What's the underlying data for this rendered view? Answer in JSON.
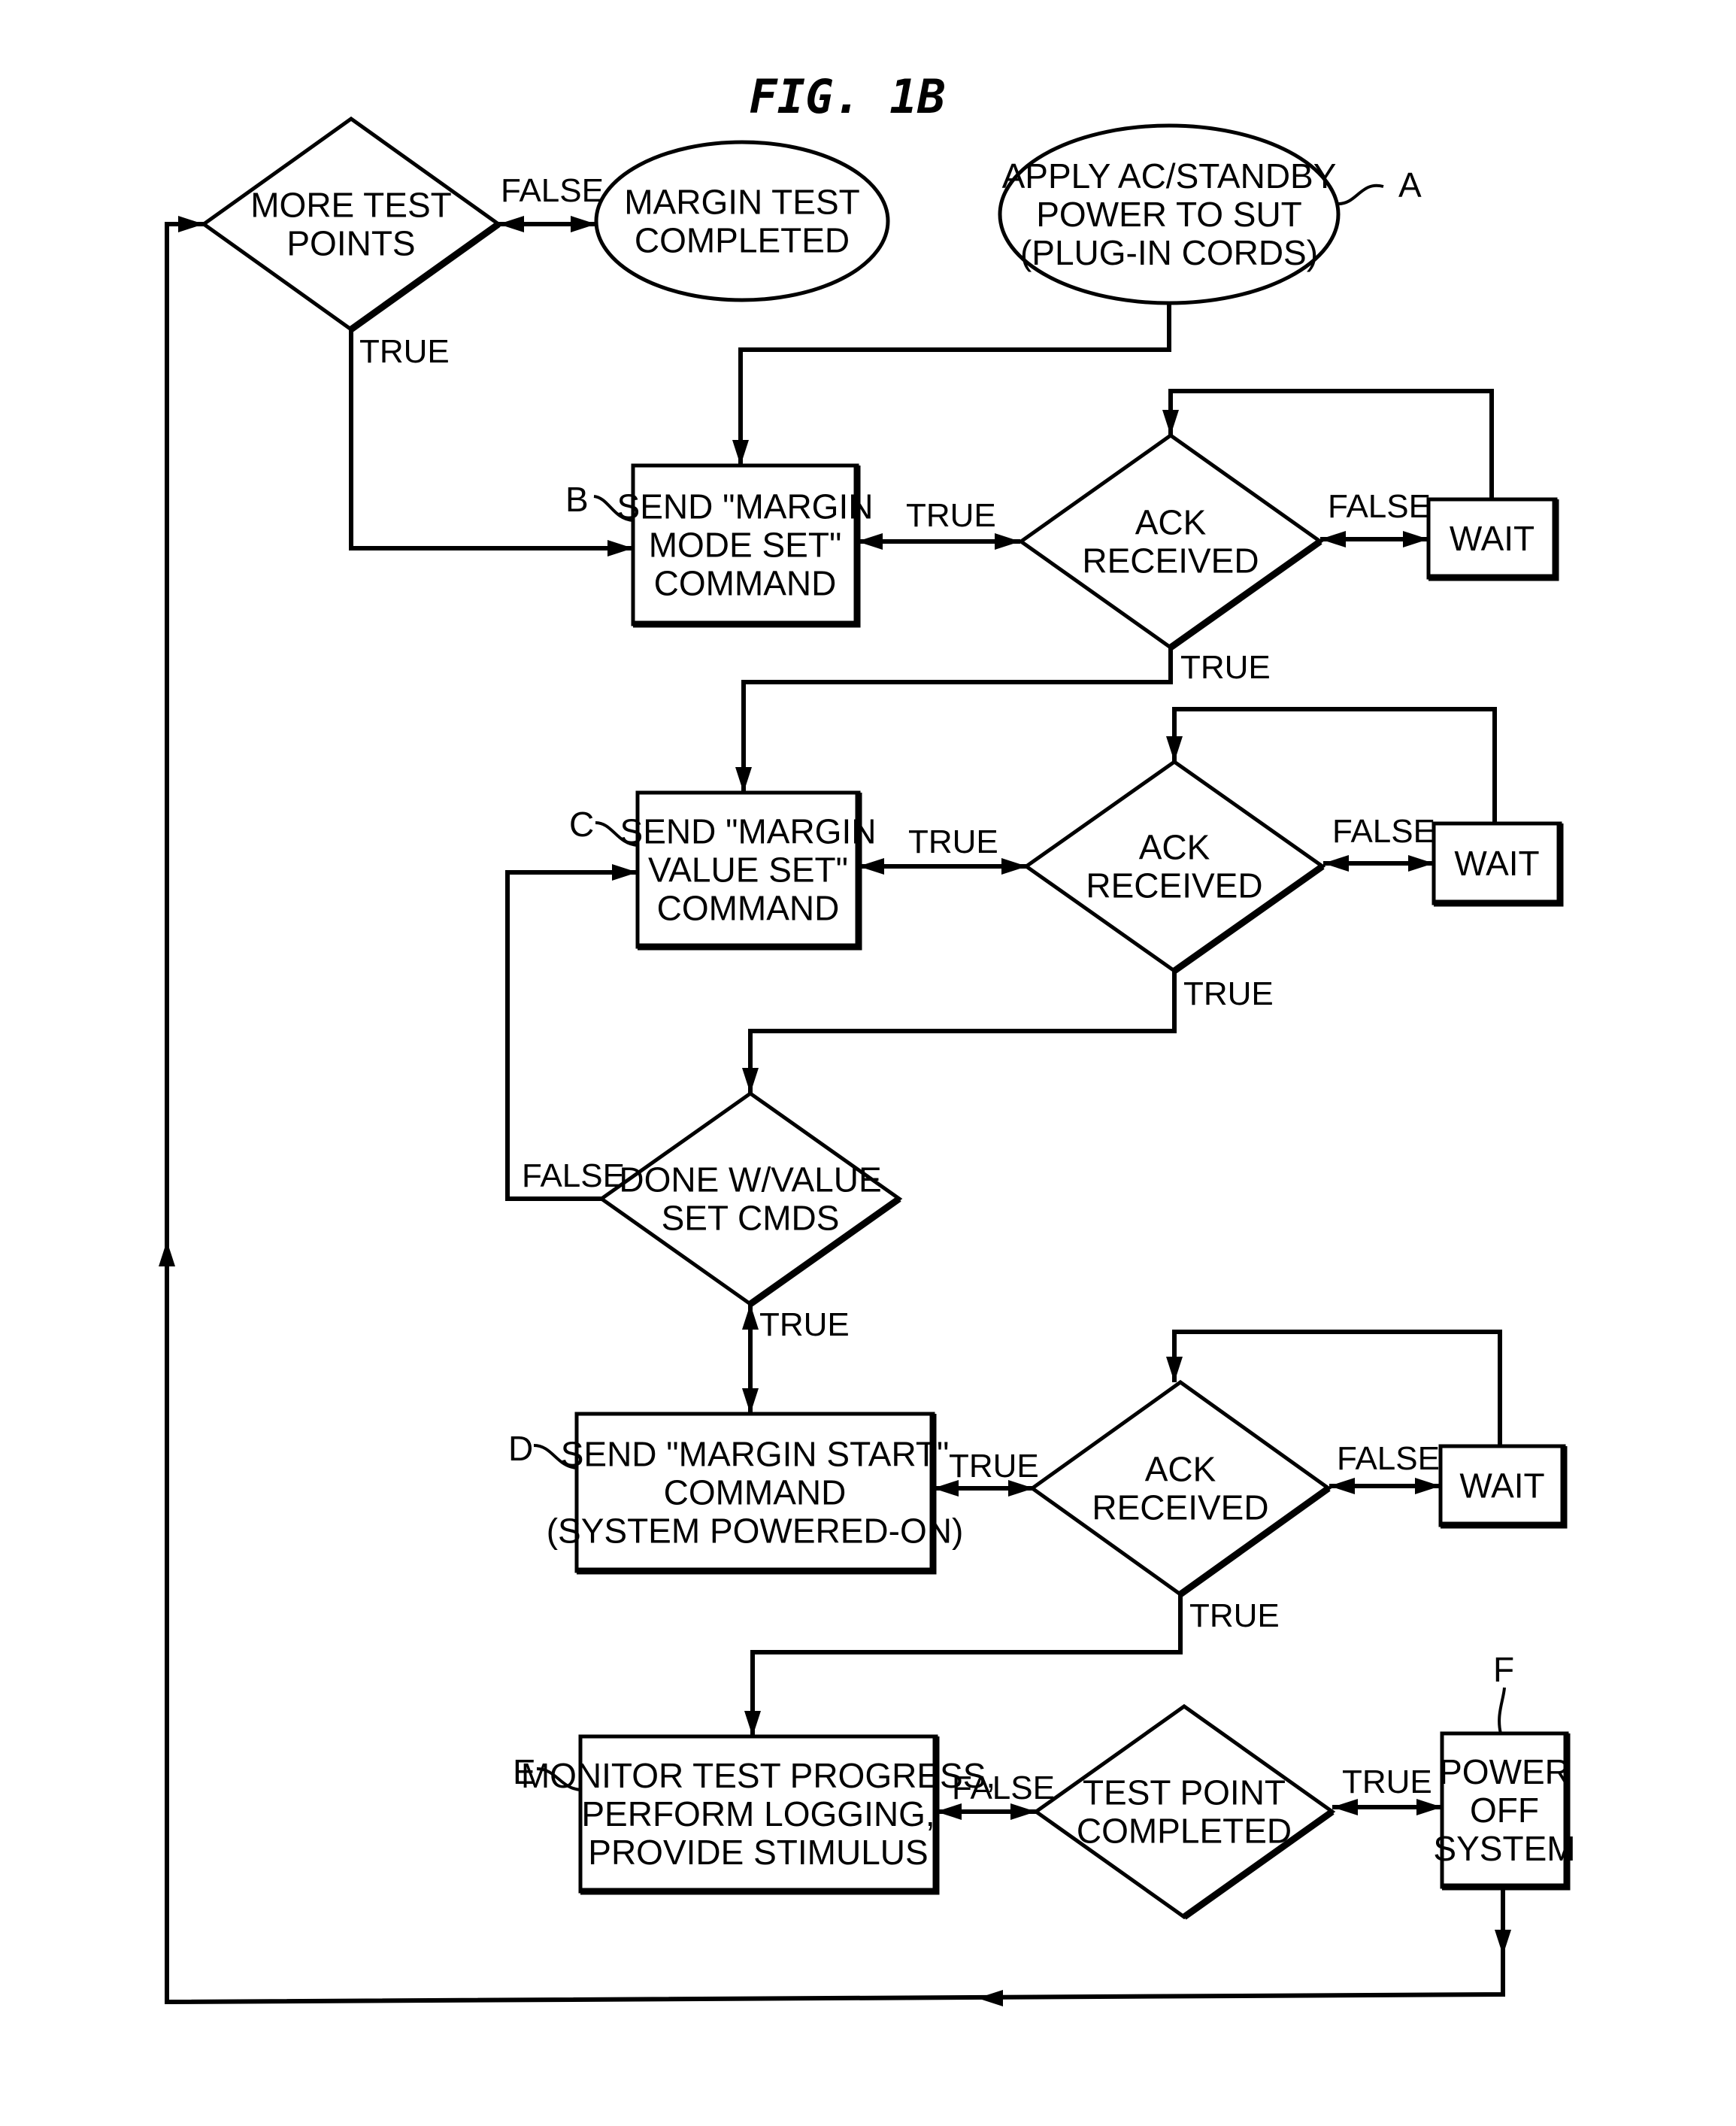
{
  "figure": {
    "title": "FIG. 1B"
  },
  "nodes": {
    "more_test_points": {
      "type": "decision",
      "lines": [
        "MORE TEST",
        "POINTS"
      ]
    },
    "margin_test_completed": {
      "type": "terminal",
      "lines": [
        "MARGIN TEST",
        "COMPLETED"
      ]
    },
    "apply_power": {
      "type": "terminal",
      "ref": "A",
      "lines": [
        "APPLY AC/STANDBY",
        "POWER TO SUT",
        "(PLUG-IN CORDS)"
      ]
    },
    "send_mode_set": {
      "type": "process",
      "ref": "B",
      "lines": [
        "SEND \"MARGIN",
        "MODE SET\"",
        "COMMAND"
      ]
    },
    "ack_1": {
      "type": "decision",
      "lines": [
        "ACK",
        "RECEIVED"
      ]
    },
    "wait_1": {
      "type": "process",
      "lines": [
        "WAIT"
      ]
    },
    "send_value_set": {
      "type": "process",
      "ref": "C",
      "lines": [
        "SEND \"MARGIN",
        "VALUE SET\"",
        "COMMAND"
      ]
    },
    "ack_2": {
      "type": "decision",
      "lines": [
        "ACK",
        "RECEIVED"
      ]
    },
    "wait_2": {
      "type": "process",
      "lines": [
        "WAIT"
      ]
    },
    "done_value_set": {
      "type": "decision",
      "lines": [
        "DONE W/VALUE",
        "SET CMDS"
      ]
    },
    "send_start": {
      "type": "process",
      "ref": "D",
      "lines": [
        "SEND \"MARGIN START\"",
        "COMMAND",
        "(SYSTEM POWERED-ON)"
      ]
    },
    "ack_3": {
      "type": "decision",
      "lines": [
        "ACK",
        "RECEIVED"
      ]
    },
    "wait_3": {
      "type": "process",
      "lines": [
        "WAIT"
      ]
    },
    "monitor": {
      "type": "process",
      "ref": "E",
      "lines": [
        "MONITOR TEST PROGRESS,",
        "PERFORM LOGGING,",
        "PROVIDE STIMULUS"
      ]
    },
    "test_point_completed": {
      "type": "decision",
      "lines": [
        "TEST POINT",
        "COMPLETED"
      ]
    },
    "power_off": {
      "type": "process",
      "ref": "F",
      "lines": [
        "POWER",
        "OFF",
        "SYSTEM"
      ]
    }
  },
  "edge_labels": {
    "more_false": "FALSE",
    "more_true": "TRUE",
    "b_true": "TRUE",
    "ack1_false": "FALSE",
    "ack1_true": "TRUE",
    "c_true": "TRUE",
    "ack2_false": "FALSE",
    "ack2_true": "TRUE",
    "done_false": "FALSE",
    "done_true": "TRUE",
    "d_true": "TRUE",
    "ack3_false": "FALSE",
    "ack3_true": "TRUE",
    "tp_false": "FALSE",
    "tp_true": "TRUE"
  }
}
